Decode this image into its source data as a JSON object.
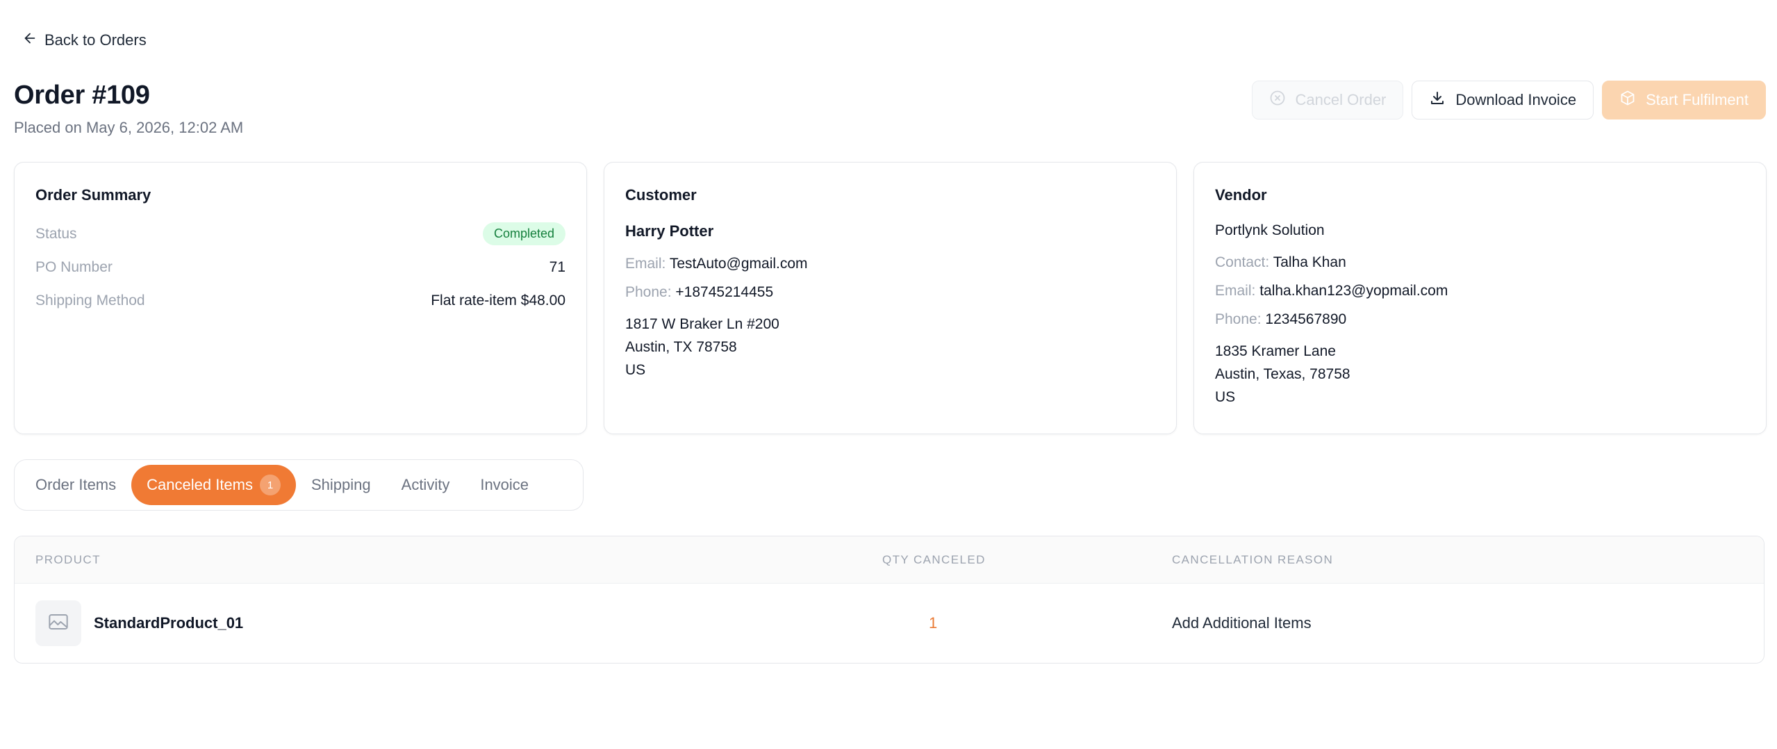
{
  "nav": {
    "back_label": "Back to Orders"
  },
  "order": {
    "title": "Order #109",
    "placed": "Placed on May 6, 2026, 12:02 AM"
  },
  "actions": {
    "cancel_label": "Cancel Order",
    "download_label": "Download Invoice",
    "fulfil_label": "Start Fulfilment"
  },
  "summary": {
    "title": "Order Summary",
    "status_label": "Status",
    "status_value": "Completed",
    "po_label": "PO Number",
    "po_value": "71",
    "shipping_label": "Shipping Method",
    "shipping_value": "Flat rate-item $48.00"
  },
  "customer": {
    "title": "Customer",
    "name": "Harry Potter",
    "email_label": "Email:",
    "email": "TestAuto@gmail.com",
    "phone_label": "Phone:",
    "phone": "+18745214455",
    "address": [
      "1817 W Braker Ln #200",
      "Austin, TX 78758",
      "US"
    ]
  },
  "vendor": {
    "title": "Vendor",
    "name": "Portlynk Solution",
    "contact_label": "Contact:",
    "contact": "Talha Khan",
    "email_label": "Email:",
    "email": "talha.khan123@yopmail.com",
    "phone_label": "Phone:",
    "phone": "1234567890",
    "address": [
      "1835 Kramer Lane",
      "Austin, Texas, 78758",
      "US"
    ]
  },
  "tabs": [
    {
      "label": "Order Items"
    },
    {
      "label": "Canceled Items",
      "count": "1"
    },
    {
      "label": "Shipping"
    },
    {
      "label": "Activity"
    },
    {
      "label": "Invoice"
    }
  ],
  "table": {
    "headers": [
      "PRODUCT",
      "QTY CANCELED",
      "CANCELLATION REASON"
    ],
    "rows": [
      {
        "product": "StandardProduct_01",
        "qty": "1",
        "reason": "Add Additional Items"
      }
    ]
  },
  "colors": {
    "accent": "#f07a34",
    "status_green": "#15803d"
  }
}
